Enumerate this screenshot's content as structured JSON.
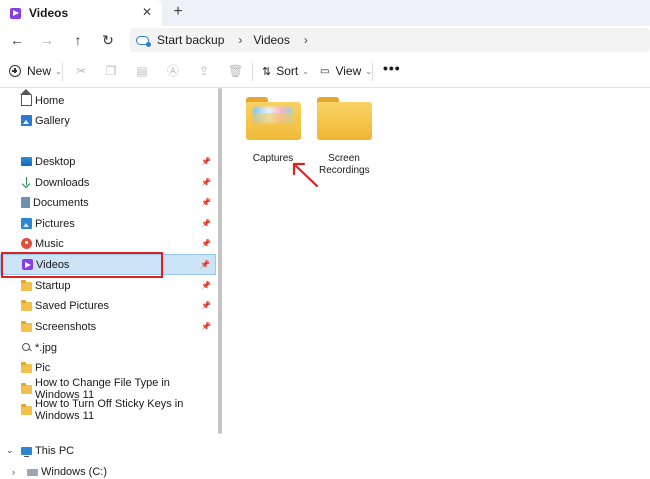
{
  "window": {
    "tab_title": "Videos",
    "tab_close": "✕",
    "new_tab": "+"
  },
  "nav": {
    "back": "←",
    "forward": "→",
    "up": "↑",
    "refresh": "↻",
    "breadcrumb": [
      "Start backup",
      "Videos"
    ],
    "sep": "›"
  },
  "toolbar": {
    "new_label": "New",
    "sort_label": "Sort",
    "view_label": "View",
    "more": "•••",
    "caret": "⌄"
  },
  "sidebar": {
    "home": "Home",
    "gallery": "Gallery",
    "desktop": "Desktop",
    "downloads": "Downloads",
    "documents": "Documents",
    "pictures": "Pictures",
    "music": "Music",
    "videos": "Videos",
    "startup": "Startup",
    "saved_pictures": "Saved Pictures",
    "screenshots": "Screenshots",
    "jpg_search": "*.jpg",
    "pic": "Pic",
    "change_file_type": "How to Change File Type in Windows 11",
    "sticky_keys": "How to Turn Off Sticky Keys in Windows 11",
    "this_pc": "This PC",
    "windows_c": "Windows (C:)",
    "pin": "📌"
  },
  "content": {
    "folders": [
      {
        "name": "Captures"
      },
      {
        "name": "Screen Recordings"
      }
    ]
  },
  "colors": {
    "selection": "#cde4f7",
    "annotation": "#e02020",
    "folder": "#f3c14b",
    "videos_icon": "#8a3ce6"
  }
}
